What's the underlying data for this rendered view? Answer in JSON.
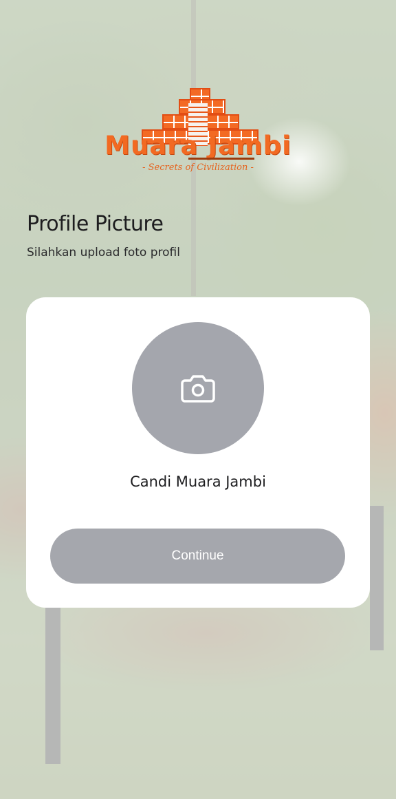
{
  "logo": {
    "title": "Muara Jambi",
    "tagline": "- Secrets of Civilization -",
    "brand_color": "#f26a22"
  },
  "header": {
    "title": "Profile Picture",
    "subtitle": "Silahkan upload foto profil"
  },
  "card": {
    "avatar_icon": "camera-icon",
    "name": "Candi Muara Jambi",
    "continue_label": "Continue"
  },
  "colors": {
    "card_bg": "#ffffff",
    "avatar_bg": "#a4a6ad",
    "button_bg": "#a5a7ad",
    "text": "#1d1d1f"
  }
}
